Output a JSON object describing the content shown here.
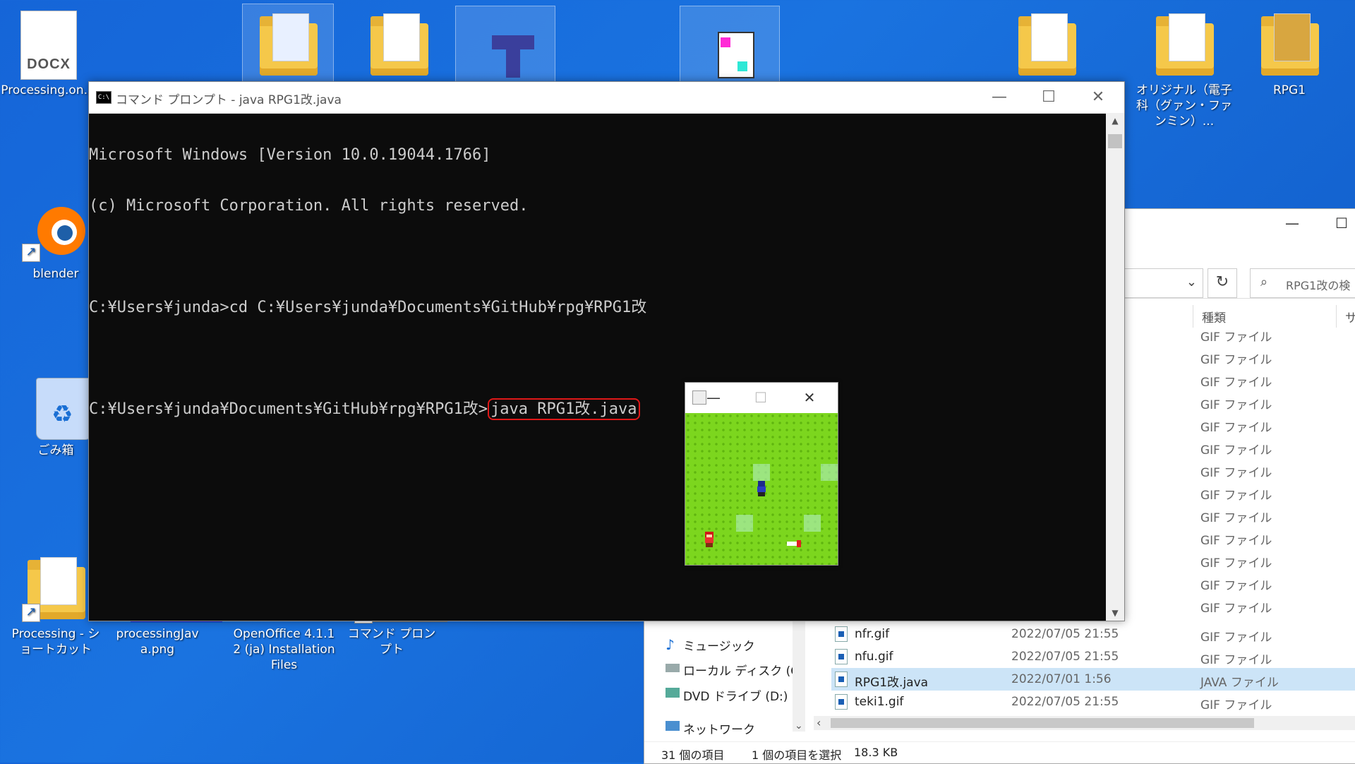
{
  "desktop": {
    "icons": [
      {
        "label": "Processing.on.l",
        "type": "docx",
        "badge": "DOCX"
      },
      {
        "label": "blender",
        "type": "app"
      },
      {
        "label": "ごみ箱",
        "type": "recycle"
      },
      {
        "label": "Processing - ショートカット",
        "type": "folder-shortcut"
      },
      {
        "label": "processingJava.png",
        "type": "image"
      },
      {
        "label": "OpenOffice 4.1.12 (ja) Installation Files",
        "type": "folder"
      },
      {
        "label": "コマンド プロンプト",
        "type": "shortcut"
      },
      {
        "label": "オリジナル（電子科（グァン・ファンミン）...",
        "type": "folder"
      },
      {
        "label": "RPG1",
        "type": "folder"
      }
    ]
  },
  "cmd": {
    "title": "コマンド プロンプト - java  RPG1改.java",
    "icon_text": "C:\\",
    "lines": [
      "Microsoft Windows [Version 10.0.19044.1766]",
      "(c) Microsoft Corporation. All rights reserved.",
      "",
      "C:¥Users¥junda>cd C:¥Users¥junda¥Documents¥GitHub¥rpg¥RPG1改",
      ""
    ],
    "prompt": "C:¥Users¥junda¥Documents¥GitHub¥rpg¥RPG1改>",
    "command": "java RPG1改.java",
    "highlight_color": "#e01818",
    "buttons": {
      "minimize": "—",
      "maximize": "☐",
      "close": "✕"
    }
  },
  "game": {
    "buttons": {
      "minimize": "—",
      "maximize": "☐",
      "close": "✕"
    },
    "field_color": "#7cd61e"
  },
  "explorer": {
    "search_placeholder": "RPG1改の検",
    "col_type": "種類",
    "col_size": "サ",
    "buttons": {
      "minimize": "—",
      "maximize": "☐"
    },
    "nav": [
      {
        "label": "ミュージック",
        "icon": "music-icon"
      },
      {
        "label": "ローカル ディスク (C",
        "icon": "disk-icon"
      },
      {
        "label": "DVD ドライブ (D:)",
        "icon": "dvd-icon"
      },
      {
        "label": "ネットワーク",
        "icon": "network-icon"
      }
    ],
    "type_only_rows": [
      "GIF ファイル",
      "GIF ファイル",
      "GIF ファイル",
      "GIF ファイル",
      "GIF ファイル",
      "GIF ファイル",
      "GIF ファイル",
      "GIF ファイル",
      "GIF ファイル",
      "GIF ファイル",
      "GIF ファイル",
      "GIF ファイル",
      "GIF ファイル"
    ],
    "files": [
      {
        "name": "nfr.gif",
        "date": "2022/07/05 21:55",
        "type": "GIF ファイル"
      },
      {
        "name": "nfu.gif",
        "date": "2022/07/05 21:55",
        "type": "GIF ファイル"
      },
      {
        "name": "RPG1改.java",
        "date": "2022/07/01 1:56",
        "type": "JAVA ファイル",
        "selected": true
      },
      {
        "name": "teki1.gif",
        "date": "2022/07/05 21:55",
        "type": "GIF ファイル"
      }
    ],
    "status": {
      "count": "31 個の項目",
      "selection": "1 個の項目を選択",
      "size": "18.3 KB"
    }
  }
}
